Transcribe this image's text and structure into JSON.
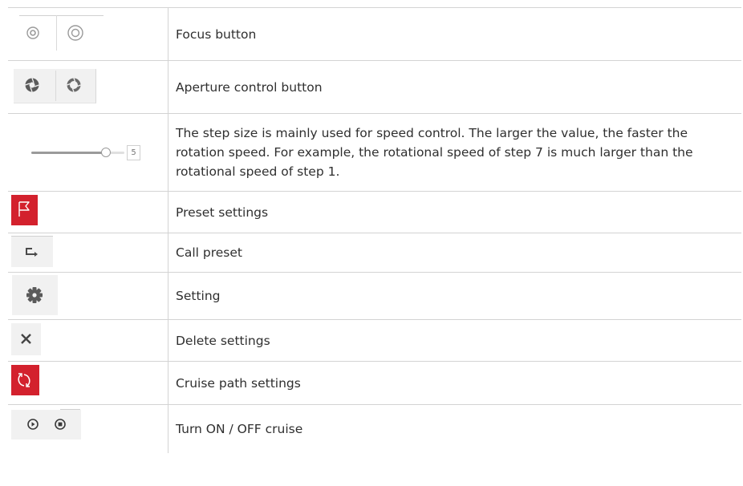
{
  "rows": [
    {
      "icon": "focus-icons",
      "label": "Focus button"
    },
    {
      "icon": "aperture-icons",
      "label": "Aperture control button"
    },
    {
      "icon": "step-slider",
      "label": "The step size is mainly used for speed control. The larger the value, the faster the rotation speed. For example, the rotational speed of step 7 is much larger than the rotational speed of step 1."
    },
    {
      "icon": "flag-icon",
      "label": "Preset settings"
    },
    {
      "icon": "call-preset-icon",
      "label": "Call preset"
    },
    {
      "icon": "gear-icon",
      "label": "Setting"
    },
    {
      "icon": "close-icon",
      "label": "Delete settings"
    },
    {
      "icon": "cruise-icon",
      "label": "Cruise path settings"
    },
    {
      "icon": "play-stop-icons",
      "label": "Turn ON / OFF cruise"
    }
  ],
  "slider": {
    "step_value": "5",
    "fill_fraction": 0.8
  },
  "colors": {
    "accent_red": "#d3212d",
    "border": "#d3d3d3",
    "icon_gray": "#8a8a8a"
  }
}
